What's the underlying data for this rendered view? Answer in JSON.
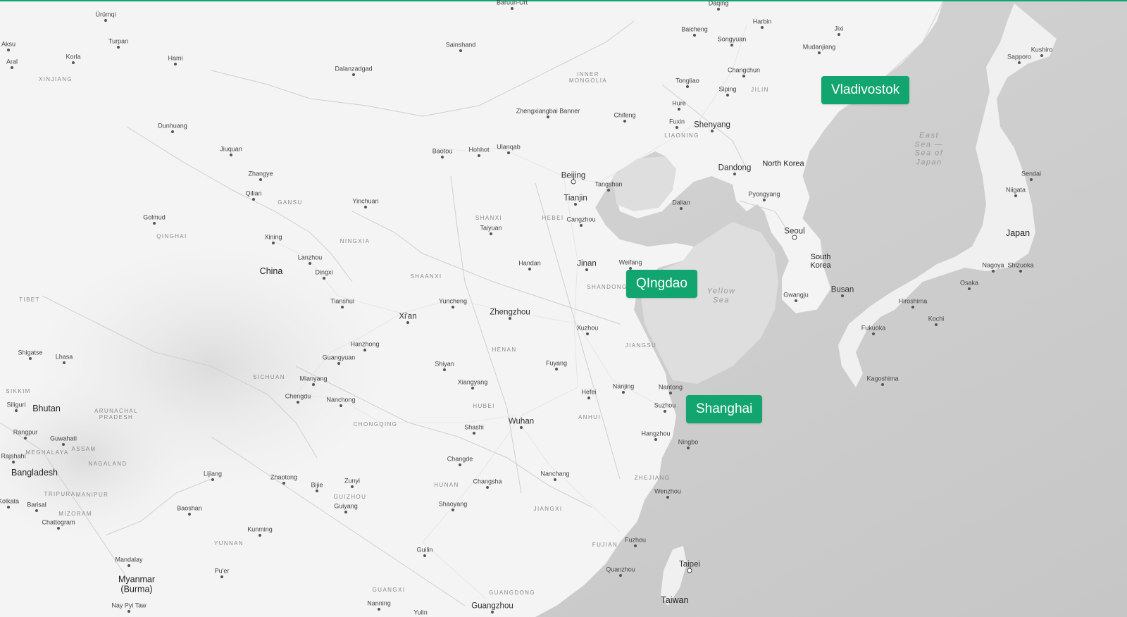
{
  "colors": {
    "accent": "#12a56f",
    "land": "#f4f4f4",
    "water": "#dcdcdc",
    "deepwater": "#cfcfcf"
  },
  "markers": [
    {
      "id": "vladivostok",
      "label": "Vladivostok"
    },
    {
      "id": "qingdao",
      "label": "QIngdao"
    },
    {
      "id": "shanghai",
      "label": "Shanghai"
    }
  ],
  "countries": [
    "China",
    "North Korea",
    "South Korea",
    "Japan",
    "Bhutan",
    "Bangladesh",
    "Myanmar (Burma)",
    "Taiwan"
  ],
  "provinces": [
    "Xinjiang",
    "Inner Mongolia",
    "Jilin",
    "Liaoning",
    "Gansu",
    "Qinghai",
    "Ningxia",
    "Shanxi",
    "Hebei",
    "Shaanxi",
    "Shandong",
    "Tibet",
    "Henan",
    "Jiangsu",
    "Sichuan",
    "Hubei",
    "Anhui",
    "Arunachal Pradesh",
    "Chongqing",
    "Meghalaya",
    "Assam",
    "Nagaland",
    "Tripura",
    "Manipur",
    "Mizoram",
    "Hunan",
    "Guizhou",
    "Zhejiang",
    "Jiangxi",
    "Yunnan",
    "Fujian",
    "Guangxi",
    "Guangdong",
    "Sikkim"
  ],
  "seas": [
    "East Sea — Sea of Japan",
    "Yellow Sea"
  ],
  "cities": [
    "Ürümqi",
    "Baruun-Urt",
    "Daqing",
    "Harbin",
    "Turpan",
    "Aksu",
    "Korla",
    "Hami",
    "Aral",
    "Sainshand",
    "Baicheng",
    "Songyuan",
    "Jixi",
    "Mudanjiang",
    "Kushiro",
    "Sapporo",
    "Dalanzadgad",
    "Changchun",
    "Tongliao",
    "Siping",
    "Hure",
    "Zhengxiangbai Banner",
    "Chifeng",
    "Fuxin",
    "Shenyang",
    "Dunhuang",
    "Jiuquan",
    "Baotou",
    "Hohhot",
    "Ulanqab",
    "Beijing",
    "Tangshan",
    "Dandong",
    "Zhangye",
    "Tianjin",
    "Qilian",
    "Yinchuan",
    "Dalian",
    "Pyongyang",
    "Sendai",
    "Niigata",
    "Golmud",
    "Cangzhou",
    "Taiyuan",
    "Seoul",
    "Xining",
    "Lanzhou",
    "Handan",
    "Jinan",
    "Weifang",
    "Dingxi",
    "Nagoya",
    "Shizuoka",
    "Osaka",
    "Hiroshima",
    "Tianshui",
    "Yuncheng",
    "Xi'an",
    "Zhengzhou",
    "Gwangju",
    "Busan",
    "Kochi",
    "Xuzhou",
    "Fukuoka",
    "Shigatse",
    "Lhasa",
    "Hanzhong",
    "Guangyuan",
    "Shiyan",
    "Fuyang",
    "Mianyang",
    "Xiangyang",
    "Kagoshima",
    "Hefei",
    "Nanjing",
    "Nantong",
    "Chengdu",
    "Nanchong",
    "Suzhou",
    "Siliguri",
    "Wuhan",
    "Rangpur",
    "Guwahati",
    "Shashi",
    "Hangzhou",
    "Ningbo",
    "Rajshahi",
    "Changde",
    "Lijiang",
    "Zhaotong",
    "Zunyi",
    "Bijie",
    "Changsha",
    "Nanchang",
    "Kolkata",
    "Barisal",
    "Baoshan",
    "Guiyang",
    "Shaoyang",
    "Wenzhou",
    "Chattogram",
    "Kunming",
    "Fuzhou",
    "Guilin",
    "Mandalay",
    "Pu'er",
    "Taipei",
    "Quanzhou",
    "Nay Pyi Taw",
    "Nanning",
    "Yulin",
    "Guangzhou"
  ]
}
